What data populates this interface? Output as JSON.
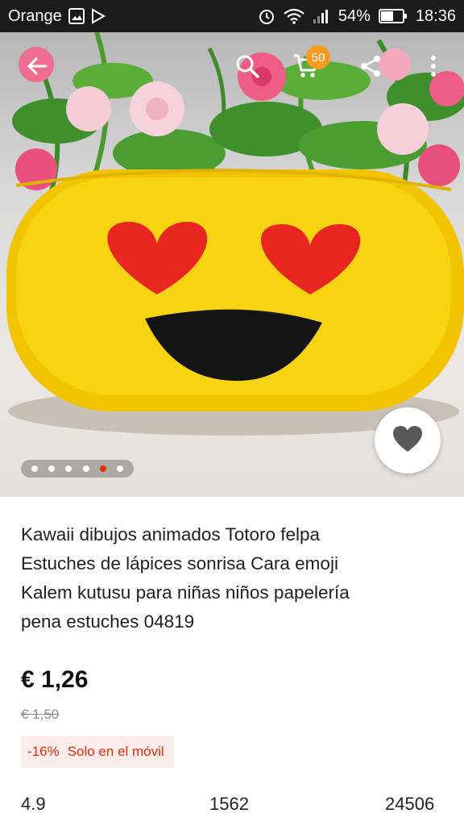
{
  "status_bar": {
    "carrier": "Orange",
    "battery": "54%",
    "time": "18:36"
  },
  "toolbar": {
    "cart_count": "50"
  },
  "gallery": {
    "dot_count": 6,
    "active_index": 4
  },
  "product": {
    "title_lines": [
      "Kawaii dibujos animados Totoro felpa",
      "Estuches de lápices sonrisa Cara emoji",
      "Kalem kutusu para niñas niños papelería",
      "pena estuches 04819"
    ],
    "price": "€ 1,26",
    "old_price": "€ 1,50",
    "discount_percent": "-16%",
    "discount_label": "Solo en el móvil"
  },
  "stats": {
    "rating": "4.9",
    "reviews": "1562",
    "orders": "24506"
  },
  "colors": {
    "accent": "#e62e04",
    "badge": "#f59a23",
    "status_bar": "#1b1b1b"
  }
}
